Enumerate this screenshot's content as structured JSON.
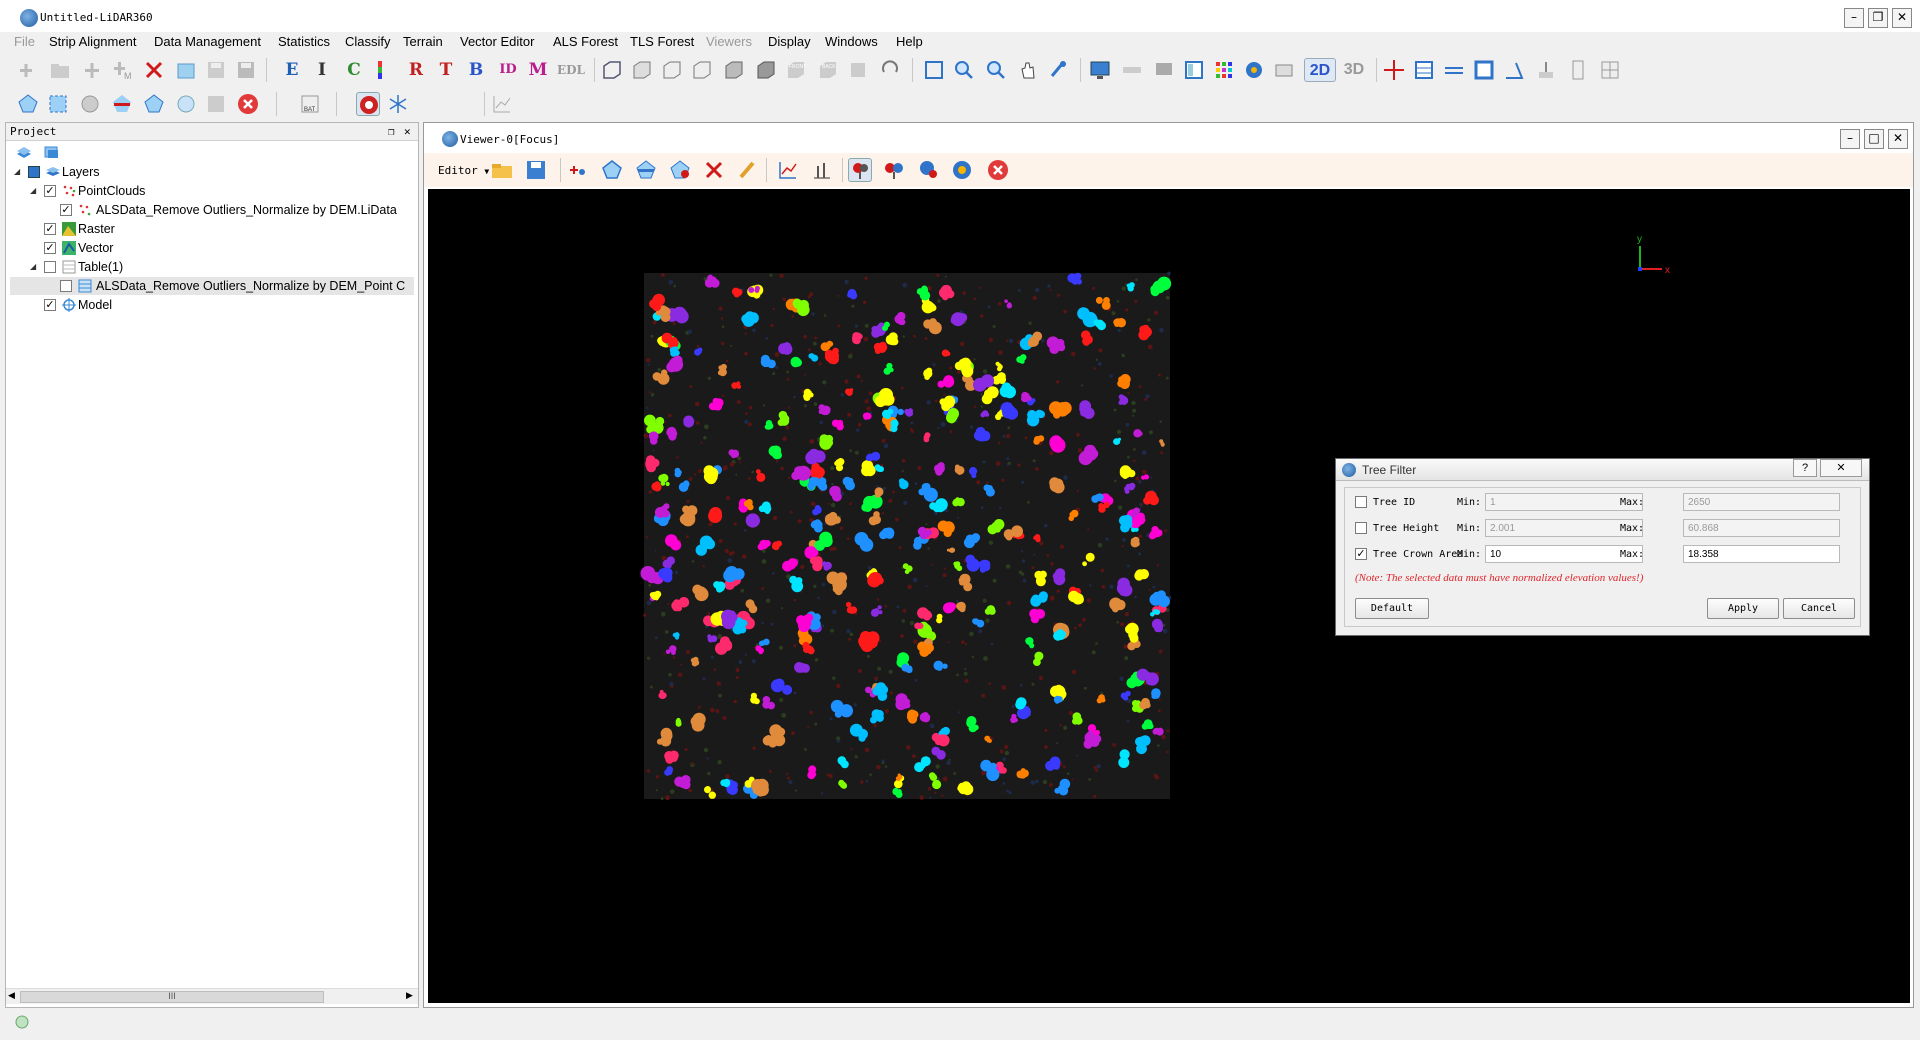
{
  "app": {
    "title": "Untitled-LiDAR360"
  },
  "menu": [
    "File",
    "Strip Alignment",
    "Data Management",
    "Statistics",
    "Classify",
    "Terrain",
    "Vector Editor",
    "ALS Forest",
    "TLS Forest",
    "Viewers",
    "Display",
    "Windows",
    "Help"
  ],
  "menu_disabled": [
    "Viewers"
  ],
  "toolbar": {
    "letters": [
      "E",
      "I",
      "C",
      "R",
      "T",
      "B",
      "ID",
      "M",
      "EDL"
    ],
    "views": [
      "FRONT",
      "BACK"
    ],
    "mode_2d": "2D",
    "mode_3d": "3D",
    "bat_label": "BAT"
  },
  "project": {
    "title": "Project",
    "tree": [
      {
        "label": "Layers",
        "level": 0,
        "checked": "partial",
        "expanded": true,
        "icon": "layers-icon"
      },
      {
        "label": "PointClouds",
        "level": 1,
        "checked": "true",
        "expanded": true,
        "icon": "pointcloud-icon"
      },
      {
        "label": "ALSData_Remove Outliers_Normalize by DEM.LiData",
        "level": 2,
        "checked": "true",
        "icon": "pointcloud-file-icon"
      },
      {
        "label": "Raster",
        "level": 1,
        "checked": "true",
        "icon": "raster-icon"
      },
      {
        "label": "Vector",
        "level": 1,
        "checked": "true",
        "icon": "vector-icon"
      },
      {
        "label": "Table(1)",
        "level": 1,
        "checked": "false",
        "expanded": true,
        "icon": "table-icon"
      },
      {
        "label": "ALSData_Remove Outliers_Normalize by DEM_Point C",
        "level": 2,
        "checked": "false",
        "icon": "table-file-icon"
      },
      {
        "label": "Model",
        "level": 1,
        "checked": "true",
        "icon": "model-icon"
      }
    ],
    "scroll_thumb_label": "III"
  },
  "viewer": {
    "title": "Viewer-0[Focus]",
    "editor_label": "Editor",
    "axis_labels": {
      "y": "y",
      "x": "x"
    }
  },
  "dialog": {
    "title": "Tree Filter",
    "help": "?",
    "rows": [
      {
        "label": "Tree ID",
        "checked": false,
        "min": "1",
        "max": "2650"
      },
      {
        "label": "Tree Height",
        "checked": false,
        "min": "2.001",
        "max": "60.868"
      },
      {
        "label": "Tree Crown Area",
        "checked": true,
        "min": "10",
        "max": "18.358"
      }
    ],
    "min_label": "Min:",
    "max_label": "Max:",
    "note": "(Note: The selected data must have normalized elevation values!)",
    "buttons": {
      "default": "Default",
      "apply": "Apply",
      "cancel": "Cancel"
    }
  },
  "colors": {
    "accent_blue": "#2f74c9",
    "viewer_toolbar_bg": "#fdf3ea",
    "note_red": "#e0242a",
    "canvas_bg": "#000000",
    "plot_bg": "#1a1a1a",
    "tree_colors": [
      "#ff2a6d",
      "#00e5ff",
      "#ffff00",
      "#00ff3c",
      "#3a3aff",
      "#ff00d4",
      "#1e90ff",
      "#e08b3c",
      "#8a2be2",
      "#ff1a1a",
      "#7fff00",
      "#00bfff",
      "#ff7f00",
      "#c21cd6"
    ]
  }
}
